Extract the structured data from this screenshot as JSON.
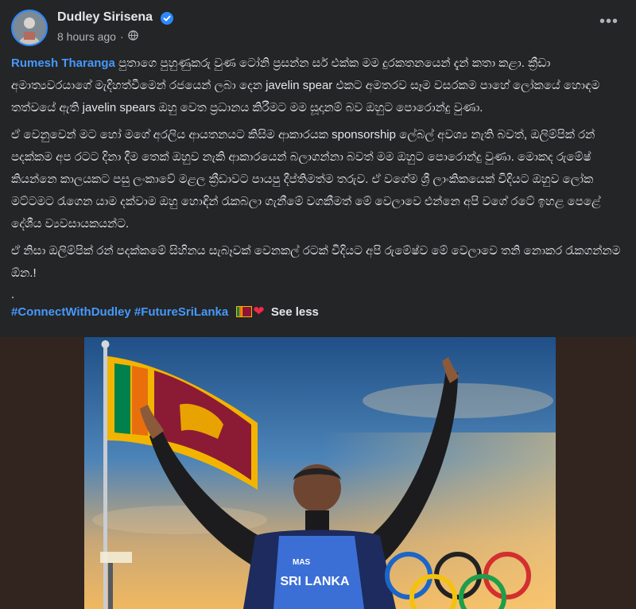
{
  "post": {
    "author": "Dudley Sirisena",
    "timestamp": "8 hours ago",
    "mention": "Rumesh Tharanga",
    "para1_rest": " පුතාගෙ පුහුණුකරු වුණ ටෝනි ප්‍රසන්න සර් එක්ක මම දුරකතනයෙන් දැන් කතා කළා. ක්‍රීඩා අමාත්‍යවරයාගේ මැදිහත්වීමෙන් රජයෙන් ලබා දෙන javelin spear එකට අමතරව සෑම වසරකම පාහේ ලෝකයේ හොඳම තත්වයේ ඇති javelin spears ඔහු වෙත ප්‍රධානය කිරීමට මම සූදානම් බව ඔහුට පොරොන්දු වුණා.",
    "para2": "ඒ වෙනුවෙන් මට හෝ මගේ අරලිය ආයතනයට කිසිම ආකාරයක sponsorship ලේබල් අවශ්‍ය නැති බවත්, ඔලිම්පික් රන් පදක්කම අප රටට දිනා දීම තෙක් ඔහුව නැකි ආකාරයෙන් බලාගන්නා බවත් මම ඔහුට පොරොන්දු වුණා. මොකද රුමේෂ් කියන්නෙ කාලයකට පසු ලංකාවේ මළල ක්‍රීඩාවට පායපු දීප්තිමත්ම තරුව. ඒ වගේම ශ්‍රී ලාංකිකයෙක් විදියට ඔහුව ලෝක මට්ටමට රැගෙන යාම දක්වාම ඔහු හොඳින් රැකබලා ගැනීමේ වගකීමත් මේ වෙලාවෙ එන්නෙ අපි වගේ රටේ ඉහළ පෙළේ දේශීය ව්‍යවසායකයන්ට.",
    "para3": "ඒ නිසා ඔලිම්පික් රන් පදක්කමේ සිහිනය සැබෑවක් වෙනකල් රටක් විදියට අපි රුමේෂ්ව මේ වෙලාවෙ තනි නොකර රැකගන්නම ඕන.!",
    "para4": ".",
    "hashtags": [
      "#ConnectWithDudley",
      "#FutureSriLanka"
    ],
    "see_less": "See less",
    "more_label": "•••"
  },
  "photo": {
    "jersey_text": "SRI LANKA",
    "brand_text": "MAS"
  },
  "icons": {
    "verified": "verified-badge-icon",
    "globe": "globe-icon",
    "flag": "sri-lanka-flag-emoji",
    "heart": "red-heart-emoji"
  },
  "colors": {
    "background": "#242526",
    "link": "#4599ff",
    "verified": "#2d88ff",
    "secondary_text": "#b0b3b8"
  }
}
